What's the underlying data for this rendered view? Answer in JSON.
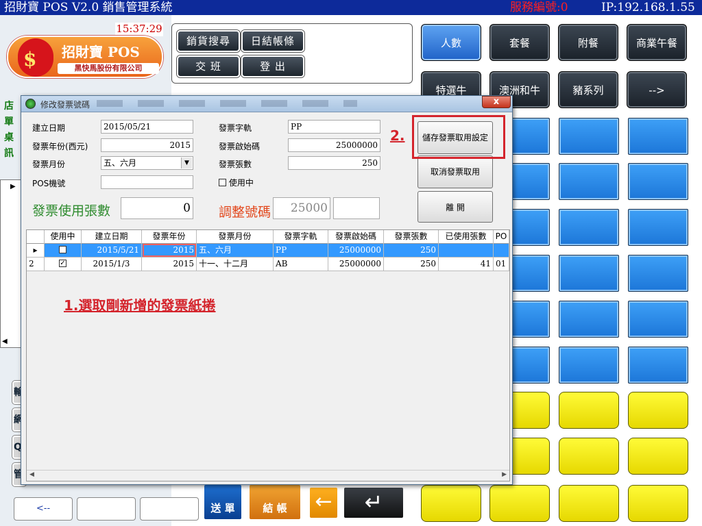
{
  "titlebar": {
    "app_title": "招財寶 POS V2.0 銷售管理系統",
    "service_no": "服務編號:0",
    "ip": "IP:192.168.1.55"
  },
  "clock": "15:37:29",
  "logo": {
    "name": "招財寶 POS",
    "company": "黑快馬股份有限公司",
    "glyph": "$"
  },
  "top_buttons": {
    "sales_search": "銷貨搜尋",
    "daily_close": "日結帳條",
    "shift_change": "交 班",
    "logout": "登 出"
  },
  "left_labels": [
    "店",
    "單",
    "桌",
    "訊"
  ],
  "side_buttons": [
    "輸",
    "網",
    "Q",
    "管"
  ],
  "bottom_buttons": {
    "back": "<--",
    "send": "送 單",
    "checkout": "結 帳",
    "back_arrow_icon": "left-arrow-icon",
    "enter_icon": "enter-icon"
  },
  "menu": {
    "categories": [
      "人數",
      "套餐",
      "附餐",
      "商業午餐",
      "特選牛",
      "澳洲和牛",
      "豬系列",
      "-->"
    ],
    "active_category": "人數"
  },
  "dialog": {
    "title": "修改發票號碼",
    "close": "x",
    "fields": {
      "create_date_label": "建立日期",
      "create_date_value": "2015/05/21",
      "year_label": "發票年份(西元)",
      "year_value": "2015",
      "month_label": "發票月份",
      "month_value": "五、六月",
      "pos_label": "POS機號",
      "pos_value": "",
      "track_label": "發票字軌",
      "track_value": "PP",
      "start_label": "發票啟始碼",
      "start_value": "25000000",
      "count_label": "發票張數",
      "count_value": "250",
      "in_use_label": "使用中",
      "used_count_label": "發票使用張數",
      "used_count_value": "0",
      "adjust_label": "調整號碼",
      "adjust_value": "25000",
      "adjust_value2": ""
    },
    "buttons": {
      "save": "儲存發票取用設定",
      "cancel": "取消發票取用",
      "leave": "離 開"
    },
    "annotations": {
      "step1": "1.選取剛新增的發票紙捲",
      "step2": "2."
    },
    "grid": {
      "columns": [
        "",
        "使用中",
        "建立日期",
        "發票年份",
        "發票月份",
        "發票字軌",
        "發票啟始碼",
        "發票張數",
        "已使用張數",
        "PO"
      ],
      "rows": [
        {
          "row_header": "",
          "in_use": false,
          "create_date": "2015/5/21",
          "year": "2015",
          "month": "五、六月",
          "track": "PP",
          "start": "25000000",
          "count": "250",
          "used": "",
          "pos": "",
          "selected": true
        },
        {
          "row_header": "2",
          "in_use": true,
          "create_date": "2015/1/3",
          "year": "2015",
          "month": "十一、十二月",
          "track": "AB",
          "start": "25000000",
          "count": "250",
          "used": "41",
          "pos": "01",
          "selected": false
        }
      ]
    }
  },
  "colors": {
    "titlebar": "#0d2a9a",
    "annotation_red": "#d4242c",
    "selection_blue": "#3399ff",
    "menu_blue": "#2a8cf0",
    "menu_yellow": "#f5ee10"
  }
}
